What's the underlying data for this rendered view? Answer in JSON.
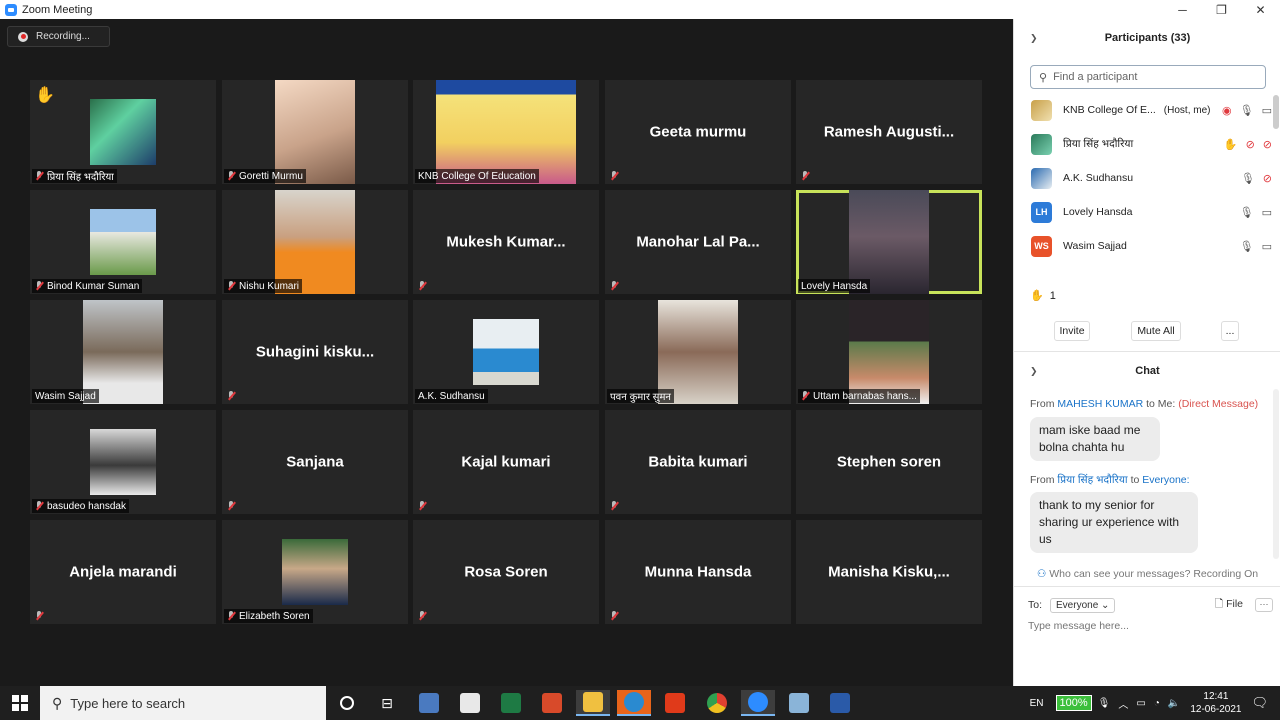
{
  "window": {
    "title": "Zoom Meeting",
    "min": "─",
    "max": "❐",
    "close": "✕"
  },
  "recording": {
    "label": "Recording..."
  },
  "tiles": {
    "r1c1": {
      "label": "प्रिया सिंह भदौरिया"
    },
    "r1c2": {
      "label": "Goretti Murmu"
    },
    "r1c3": {
      "label": "KNB College Of Education"
    },
    "r1c4": {
      "name": "Geeta murmu"
    },
    "r1c5": {
      "name": "Ramesh  Augusti..."
    },
    "r2c1": {
      "label": "Binod Kumar Suman"
    },
    "r2c2": {
      "label": "Nishu Kumari"
    },
    "r2c3": {
      "name": "Mukesh  Kumar..."
    },
    "r2c4": {
      "name": "Manohar Lal Pa..."
    },
    "r2c5": {
      "label": "Lovely Hansda"
    },
    "r3c1": {
      "label": "Wasim Sajjad"
    },
    "r3c2": {
      "name": "Suhagini  kisku..."
    },
    "r3c3": {
      "label": "A.K. Sudhansu"
    },
    "r3c4": {
      "label": "पवन कुमार सुमन"
    },
    "r3c5": {
      "label": "Uttam barnabas hans..."
    },
    "r4c1": {
      "label": "basudeo hansdak"
    },
    "r4c2": {
      "name": "Sanjana"
    },
    "r4c3": {
      "name": "Kajal kumari"
    },
    "r4c4": {
      "name": "Babita kumari"
    },
    "r4c5": {
      "name": "Stephen soren"
    },
    "r5c1": {
      "name": "Anjela marandi"
    },
    "r5c2": {
      "label": "Elizabeth Soren"
    },
    "r5c3": {
      "name": "Rosa Soren"
    },
    "r5c4": {
      "name": "Munna Hansda"
    },
    "r5c5": {
      "name": "Manisha  Kisku,..."
    }
  },
  "participants": {
    "title": "Participants (33)",
    "search_placeholder": "Find a participant",
    "list": [
      {
        "name": "KNB College Of E...",
        "role": "(Host, me)"
      },
      {
        "name": "प्रिया सिंह भदौरिया"
      },
      {
        "name": "A.K. Sudhansu"
      },
      {
        "name": "Lovely Hansda",
        "initials": "LH"
      },
      {
        "name": "Wasim Sajjad",
        "initials": "WS"
      }
    ],
    "raised_count": "1",
    "invite": "Invite",
    "mute_all": "Mute All",
    "more": "..."
  },
  "chat": {
    "title": "Chat",
    "messages": [
      {
        "from": "From",
        "sender": "MAHESH KUMAR",
        "to": "to Me:",
        "tag": "(Direct Message)",
        "text": "mam iske baad me bolna chahta hu"
      },
      {
        "from": "From",
        "sender": "प्रिया सिंह भदौरिया",
        "to": "to",
        "recipient": "Everyone:",
        "text": "thank to my senior for sharing ur experience with us"
      }
    ],
    "who_can_see": "Who can see your messages? Recording On",
    "to_label": "To:",
    "to_value": "Everyone",
    "file_label": "File",
    "more": "···",
    "input_placeholder": "Type message here..."
  },
  "taskbar": {
    "search_placeholder": "Type here to search",
    "lang": "EN",
    "battery": "100%",
    "time": "12:41",
    "date": "12-06-2021"
  },
  "colors": {
    "accent": "#2d8cff",
    "active_speaker": "#c8e35a",
    "lh_avatar": "#2d7bd8",
    "ws_avatar": "#e8522a"
  }
}
